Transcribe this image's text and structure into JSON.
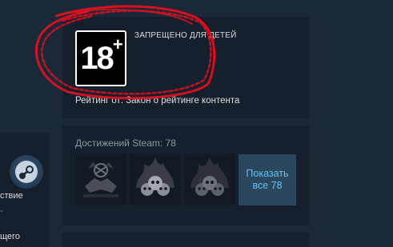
{
  "rating": {
    "badge_number": "18",
    "badge_plus": "+",
    "title": "ЗАПРЕЩЕНО ДЛЯ ДЕТЕЙ",
    "source": "Рейтинг от: Закон о рейтинге контента"
  },
  "achievements": {
    "title": "Достижений Steam: 78",
    "icons": [
      "biohazard-handshake-icon",
      "burning-skulls-icon",
      "burning-skulls-icon"
    ],
    "show_all_label": "Показать все 78"
  },
  "sidebar": {
    "text1": "ствие",
    "text2": "-",
    "text3": "щего"
  },
  "colors": {
    "background": "#1b2838",
    "card": "#16202d",
    "accent": "#66c0f4",
    "button_bg": "#2a475e",
    "scribble": "#e01020"
  }
}
